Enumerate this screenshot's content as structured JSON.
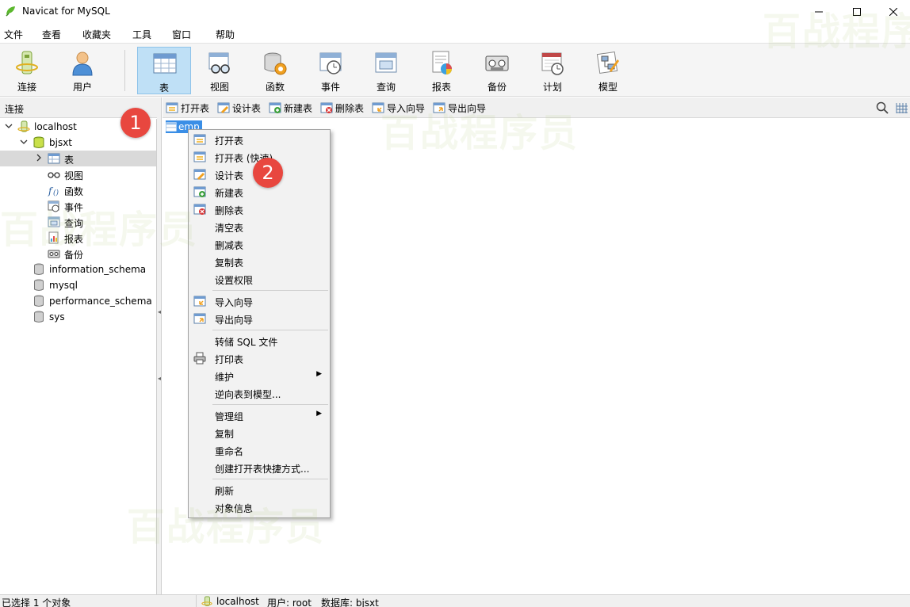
{
  "window": {
    "title": "Navicat for MySQL"
  },
  "menu": [
    "文件",
    "查看",
    "收藏夹",
    "工具",
    "窗口",
    "帮助"
  ],
  "toolbar": {
    "connect": "连接",
    "user": "用户",
    "table": "表",
    "view": "视图",
    "function": "函数",
    "event": "事件",
    "query": "查询",
    "report": "报表",
    "backup": "备份",
    "schedule": "计划",
    "model": "模型"
  },
  "left": {
    "header": "连接"
  },
  "tree": {
    "localhost": "localhost",
    "bjsxt": "bjsxt",
    "tables": "表",
    "views": "视图",
    "functions": "函数",
    "events": "事件",
    "queries": "查询",
    "reports": "报表",
    "backups": "备份",
    "information_schema": "information_schema",
    "mysql": "mysql",
    "performance_schema": "performance_schema",
    "sys": "sys"
  },
  "obj_toolbar": {
    "open": "打开表",
    "design": "设计表",
    "new": "新建表",
    "delete": "删除表",
    "import": "导入向导",
    "export": "导出向导"
  },
  "content": {
    "item": "emp"
  },
  "context_menu": {
    "open": "打开表",
    "open_quick": "打开表 (快速)",
    "design": "设计表",
    "new": "新建表",
    "delete": "删除表",
    "empty": "清空表",
    "truncate": "删减表",
    "copy_table": "复制表",
    "permissions": "设置权限",
    "import": "导入向导",
    "export": "导出向导",
    "dump_sql": "转储 SQL 文件",
    "print": "打印表",
    "maintain": "维护",
    "reverse": "逆向表到模型...",
    "group": "管理组",
    "copy": "复制",
    "rename": "重命名",
    "shortcut": "创建打开表快捷方式...",
    "refresh": "刷新",
    "object_info": "对象信息"
  },
  "statusbar": {
    "selected": "已选择 1 个对象",
    "host": "localhost",
    "user": "用户: root",
    "database": "数据库: bjsxt"
  },
  "badges": {
    "one": "1",
    "two": "2"
  },
  "watermark": "百战程序员"
}
